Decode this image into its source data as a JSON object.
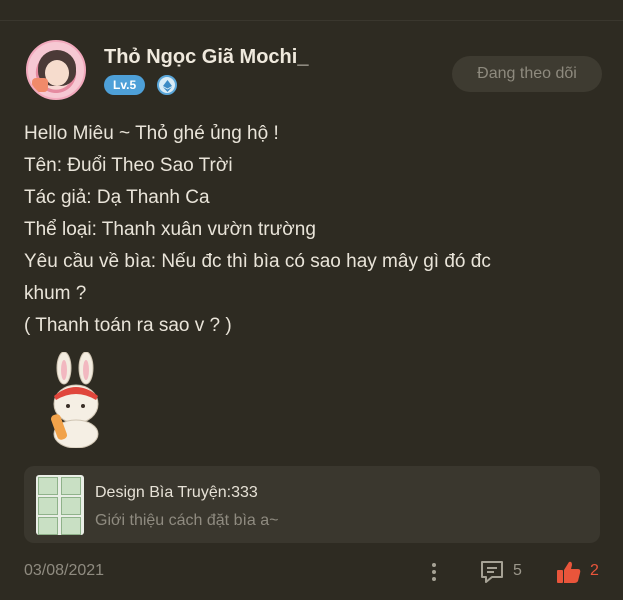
{
  "post": {
    "author": {
      "name": "Thỏ Ngọc Giã Mochi_",
      "level": "Lv.5"
    },
    "follow_button": "Đang theo dõi",
    "content_lines": [
      "Hello Miêu ~ Thỏ ghé ủng hộ !",
      "Tên: Đuổi Theo Sao Trời",
      "Tác giả: Dạ Thanh Ca",
      "Thể loại: Thanh xuân vườn trường",
      "Yêu cầu về bìa: Nếu đc thì bìa có sao hay mây gì đó đc",
      "khum ?",
      "( Thanh toán ra sao v ? )"
    ],
    "linked_post": {
      "title": "Design Bìa Truyện:333",
      "subtitle": "Giới thiệu cách đặt bìa a~"
    },
    "date": "03/08/2021",
    "comment_count": "5",
    "like_count": "2"
  },
  "icons": {
    "level": "ethereum-icon",
    "more": "more-vertical-icon",
    "comment": "comment-icon",
    "like": "thumbs-up-icon",
    "sticker": "bunny-sticker"
  },
  "colors": {
    "background": "#2e2b22",
    "card": "#3a372e",
    "level_badge": "#4ea0d8",
    "like_accent": "#e9553b",
    "muted_text": "#8f8b80"
  }
}
